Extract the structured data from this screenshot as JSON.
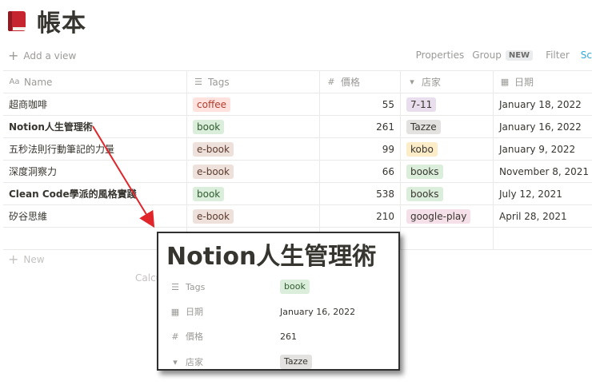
{
  "page": {
    "title": "帳本"
  },
  "toolbar": {
    "add_view": "Add a view",
    "properties": "Properties",
    "group": "Group",
    "new_badge": "NEW",
    "filter": "Filter",
    "search_partial": "Sc"
  },
  "columns": {
    "name": "Name",
    "tags": "Tags",
    "price": "價格",
    "store": "店家",
    "date": "日期"
  },
  "rows": [
    {
      "name": "超商咖啡",
      "tag": "coffee",
      "tag_color": "#ffe2dd",
      "tag_text": "#b33c2f",
      "price": "55",
      "store": "7-11",
      "store_color": "#e8deee",
      "date": "January 18, 2022"
    },
    {
      "name": "Notion人生管理術",
      "tag": "book",
      "tag_color": "#dbeddb",
      "tag_text": "#2f5c2f",
      "price": "261",
      "store": "Tazze",
      "store_color": "#e3e2e0",
      "date": "January 16, 2022"
    },
    {
      "name": "五秒法則行動筆記的力量",
      "tag": "e-book",
      "tag_color": "#eee0da",
      "tag_text": "#5c3b2e",
      "price": "99",
      "store": "kobo",
      "store_color": "#fdecc8",
      "date": "January 9, 2022"
    },
    {
      "name": "深度洞察力",
      "tag": "e-book",
      "tag_color": "#eee0da",
      "tag_text": "#5c3b2e",
      "price": "66",
      "store": "books",
      "store_color": "#dbeddb",
      "date": "November 8, 2021"
    },
    {
      "name": "Clean Code學派的風格實踐",
      "tag": "book",
      "tag_color": "#dbeddb",
      "tag_text": "#2f5c2f",
      "price": "538",
      "store": "books",
      "store_color": "#dbeddb",
      "date": "July 12, 2021"
    },
    {
      "name": "矽谷思維",
      "tag": "e-book",
      "tag_color": "#eee0da",
      "tag_text": "#5c3b2e",
      "price": "210",
      "store": "google-play",
      "store_color": "#f5e0e9",
      "date": "April 28, 2021"
    }
  ],
  "footer": {
    "new_label": "New",
    "calc_label": "Calcu"
  },
  "zoom": {
    "title": "Notion人生管理術",
    "props": {
      "tags_label": "Tags",
      "tags_value": "book",
      "date_label": "日期",
      "date_value": "January 16, 2022",
      "price_label": "價格",
      "price_value": "261",
      "store_label": "店家",
      "store_value": "Tazze"
    }
  },
  "colors": {
    "arrow": "#e0262a",
    "accent": "#2eaadc"
  }
}
